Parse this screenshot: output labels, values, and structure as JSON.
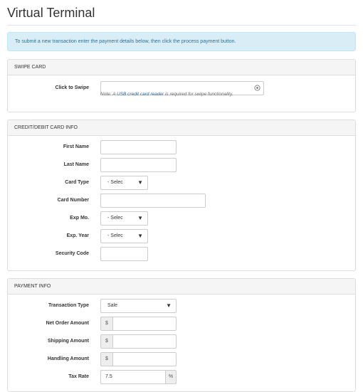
{
  "page": {
    "title": "Virtual Terminal",
    "alert": "To submit a new transaction enter the payment details below, then click the process payment button."
  },
  "swipe": {
    "heading": "SWIPE CARD",
    "label": "Click to Swipe",
    "note_prefix": "Note: A ",
    "note_link": "USB credit card reader",
    "note_suffix": " is required for swipe functionality.",
    "icon": "target-icon"
  },
  "card": {
    "heading": "CREDIT/DEBIT CARD INFO",
    "first_name_label": "First Name",
    "last_name_label": "Last Name",
    "card_type_label": "Card Type",
    "card_type_value": "- Selec",
    "card_number_label": "Card Number",
    "exp_mo_label": "Exp Mo.",
    "exp_mo_value": "- Selec",
    "exp_year_label": "Exp. Year",
    "exp_year_value": "- Selec",
    "security_code_label": "Security Code"
  },
  "payment": {
    "heading": "PAYMENT INFO",
    "transaction_type_label": "Transaction Type",
    "transaction_type_value": "Sale",
    "net_order_label": "Net Order Amount",
    "shipping_label": "Shipping Amount",
    "handling_label": "Handling Amount",
    "currency_symbol": "$",
    "tax_rate_label": "Tax Rate",
    "tax_rate_value": "7.5",
    "percent_symbol": "%"
  },
  "dropdown_arrow": "▼"
}
